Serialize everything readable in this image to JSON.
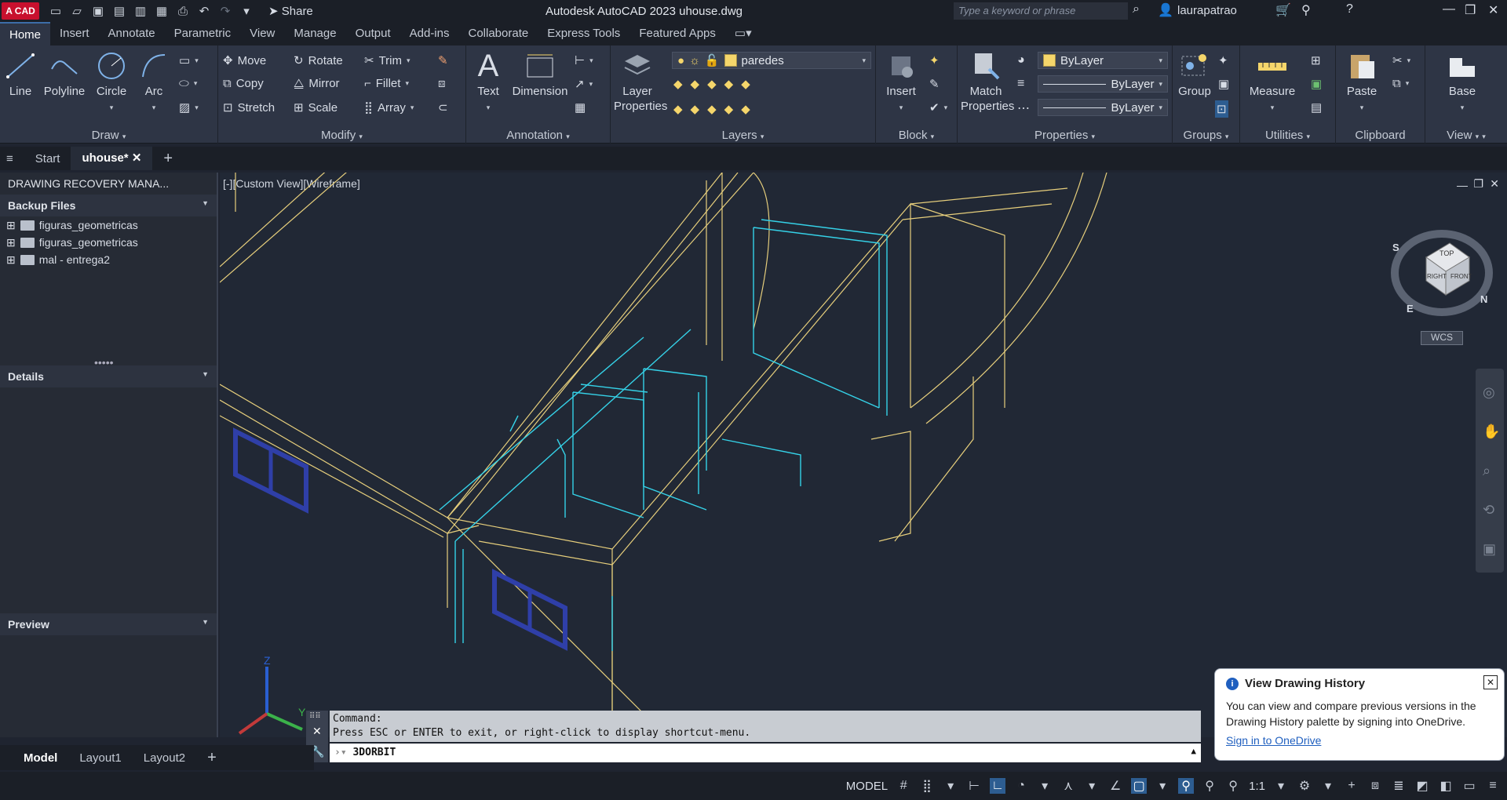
{
  "titlebar": {
    "logo": "A CAD",
    "share": "Share",
    "app_title": "Autodesk AutoCAD 2023   uhouse.dwg",
    "search_placeholder": "Type a keyword or phrase",
    "user": "laurapatrao"
  },
  "ribbon_tabs": [
    "Home",
    "Insert",
    "Annotate",
    "Parametric",
    "View",
    "Manage",
    "Output",
    "Add-ins",
    "Collaborate",
    "Express Tools",
    "Featured Apps"
  ],
  "ribbon": {
    "draw": {
      "title": "Draw",
      "line": "Line",
      "polyline": "Polyline",
      "circle": "Circle",
      "arc": "Arc"
    },
    "modify": {
      "title": "Modify",
      "move": "Move",
      "rotate": "Rotate",
      "trim": "Trim",
      "copy": "Copy",
      "mirror": "Mirror",
      "fillet": "Fillet",
      "stretch": "Stretch",
      "scale": "Scale",
      "array": "Array"
    },
    "annotation": {
      "title": "Annotation",
      "text": "Text",
      "dimension": "Dimension"
    },
    "layers": {
      "title": "Layers",
      "layer_properties_1": "Layer",
      "layer_properties_2": "Properties",
      "current_layer": "paredes"
    },
    "block": {
      "title": "Block",
      "insert": "Insert"
    },
    "properties": {
      "title": "Properties",
      "match_1": "Match",
      "match_2": "Properties",
      "color": "ByLayer",
      "linetype": "ByLayer",
      "lineweight": "ByLayer"
    },
    "groups": {
      "title": "Groups",
      "group": "Group"
    },
    "utilities": {
      "title": "Utilities",
      "measure": "Measure"
    },
    "clipboard": {
      "title": "Clipboard",
      "paste": "Paste"
    },
    "view": {
      "title": "View",
      "base": "Base"
    }
  },
  "doc_tabs": {
    "start": "Start",
    "active": "uhouse*"
  },
  "palette": {
    "title": "DRAWING RECOVERY MANA...",
    "backup_header": "Backup Files",
    "files": [
      "figuras_geometricas",
      "figuras_geometricas",
      "mal - entrega2"
    ],
    "details_header": "Details",
    "preview_header": "Preview"
  },
  "viewport": {
    "label": "[-][Custom View][Wireframe]",
    "viewcube_top": "TOP",
    "viewcube_right": "RIGHT",
    "viewcube_front": "FRONT",
    "wcs": "WCS",
    "compass_s": "S",
    "compass_e": "E",
    "compass_n": "N",
    "axis_z": "Z",
    "axis_y": "Y"
  },
  "command": {
    "line1": "Command:",
    "line2": "Press ESC or ENTER to exit, or right-click to display shortcut-menu.",
    "input": "3DORBIT"
  },
  "layout_tabs": [
    "Model",
    "Layout1",
    "Layout2"
  ],
  "status": {
    "model": "MODEL",
    "scale": "1:1"
  },
  "notification": {
    "title": "View Drawing History",
    "body": "You can view and compare previous versions in the Drawing History palette by signing into OneDrive.",
    "link": "Sign in to OneDrive"
  }
}
